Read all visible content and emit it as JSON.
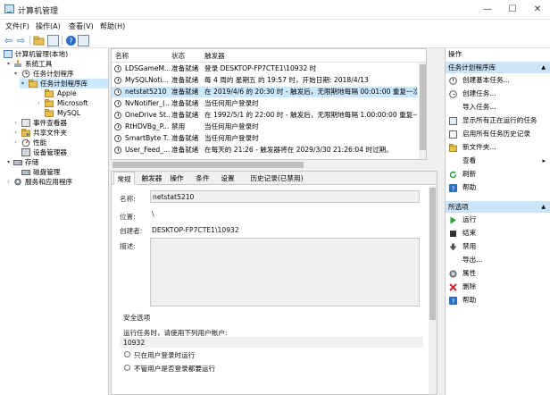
{
  "window": {
    "title": "计算机管理",
    "min_glyph": "—",
    "max_glyph": "☐",
    "close_glyph": "✕"
  },
  "menubar": {
    "items": [
      "文件(F)",
      "操作(A)",
      "查看(V)",
      "帮助(H)"
    ]
  },
  "toolbar": {
    "back_glyph": "⇦",
    "forward_glyph": "⇨"
  },
  "tree": {
    "items": [
      {
        "label": "计算机管理(本地)",
        "icon": "computer-icon"
      },
      {
        "label": "系统工具",
        "icon": "tools-icon",
        "expander": "▾"
      },
      {
        "label": "任务计划程序",
        "icon": "clock-icon",
        "expander": "▾"
      },
      {
        "label": "任务计划程序库",
        "icon": "folder-icon",
        "expander": "▾"
      },
      {
        "label": "Apple",
        "icon": "folder-icon"
      },
      {
        "label": "Microsoft",
        "icon": "folder-icon",
        "expander": "›"
      },
      {
        "label": "MySQL",
        "icon": "folder-icon"
      },
      {
        "label": "事件查看器",
        "icon": "event-viewer-icon",
        "expander": "›"
      },
      {
        "label": "共享文件夹",
        "icon": "shared-folder-icon",
        "expander": "›"
      },
      {
        "label": "性能",
        "icon": "performance-icon",
        "expander": "›"
      },
      {
        "label": "设备管理器",
        "icon": "device-manager-icon"
      },
      {
        "label": "存储",
        "icon": "storage-icon",
        "expander": "▾"
      },
      {
        "label": "磁盘管理",
        "icon": "disk-icon"
      },
      {
        "label": "服务和应用程序",
        "icon": "services-icon",
        "expander": "›"
      }
    ]
  },
  "task_list": {
    "headers": [
      "名称",
      "状态",
      "触发器"
    ],
    "rows": [
      {
        "name": "LDSGameM...",
        "status": "准备就绪",
        "trigger": "登录 DESKTOP-FP7CTE1\\10932 时"
      },
      {
        "name": "MySQLNoti...",
        "status": "准备就绪",
        "trigger": "每 4 周的 星期五 的 19:57 时，开始日期: 2018/4/13"
      },
      {
        "name": "netstat5210",
        "status": "准备就绪",
        "trigger": "在 2019/4/6 的 20:30 时 - 触发后，无限期地每隔 00:01:00 重复一次。"
      },
      {
        "name": "NvNotifier_(...",
        "status": "准备就绪",
        "trigger": "当任何用户登录时"
      },
      {
        "name": "OneDrive St...",
        "status": "准备就绪",
        "trigger": "在 1992/5/1 的 22:00 时 - 触发后，无限期地每隔 1.00:00:00 重复一次。"
      },
      {
        "name": "RtHDVBg_P...",
        "status": "禁用",
        "trigger": "当任何用户登录时"
      },
      {
        "name": "SmartByte T...",
        "status": "准备就绪",
        "trigger": "当任何用户登录时"
      },
      {
        "name": "User_Feed_...",
        "status": "准备就绪",
        "trigger": "在每天的 21:26 - 触发器将在 2029/3/30 21:26:04 时过期。"
      }
    ]
  },
  "detail": {
    "tabs": [
      "常规",
      "触发器",
      "操作",
      "条件",
      "设置",
      "历史记录(已禁用)"
    ],
    "name_label": "名称:",
    "name_value": "netstat5210",
    "location_label": "位置:",
    "location_value": "\\",
    "author_label": "创建者:",
    "author_value": "DESKTOP-FP7CTE1\\10932",
    "description_label": "描述:",
    "security_header": "安全选项",
    "run_as_text": "运行任务时，请使用下列用户帐户:",
    "run_as_user": "10932",
    "radio_logged_on": "只在用户登录时运行",
    "radio_whether": "不管用户是否登录都要运行"
  },
  "actions": {
    "title": "操作",
    "section1": "任务计划程序库",
    "section1_items": [
      {
        "label": "创建基本任务...",
        "icon": "create-basic-task-icon"
      },
      {
        "label": "创建任务...",
        "icon": "create-task-icon"
      },
      {
        "label": "导入任务...",
        "icon": "blank-icon"
      },
      {
        "label": "显示所有正在运行的任务",
        "icon": "running-tasks-icon"
      },
      {
        "label": "启用所有任务历史记录",
        "icon": "history-icon"
      },
      {
        "label": "新文件夹...",
        "icon": "new-folder-icon"
      },
      {
        "label": "查看",
        "icon": "blank-icon",
        "submenu": "▸"
      },
      {
        "label": "刷新",
        "icon": "refresh-icon"
      },
      {
        "label": "帮助",
        "icon": "help-icon"
      }
    ],
    "section2": "所选项",
    "section2_items": [
      {
        "label": "运行",
        "icon": "run-icon"
      },
      {
        "label": "结束",
        "icon": "stop-icon"
      },
      {
        "label": "禁用",
        "icon": "disable-icon"
      },
      {
        "label": "导出...",
        "icon": "blank-icon"
      },
      {
        "label": "属性",
        "icon": "properties-icon"
      },
      {
        "label": "删除",
        "icon": "delete-icon"
      },
      {
        "label": "帮助",
        "icon": "help-icon"
      }
    ],
    "collapse_glyph": "▲"
  },
  "colors": {
    "selection": "#cce8ff",
    "action_section": "#cce4f7",
    "run_green": "#2e9e3e",
    "delete_red": "#d2232a",
    "help_blue": "#2b6cc4",
    "folder_yellow": "#e8c150"
  }
}
